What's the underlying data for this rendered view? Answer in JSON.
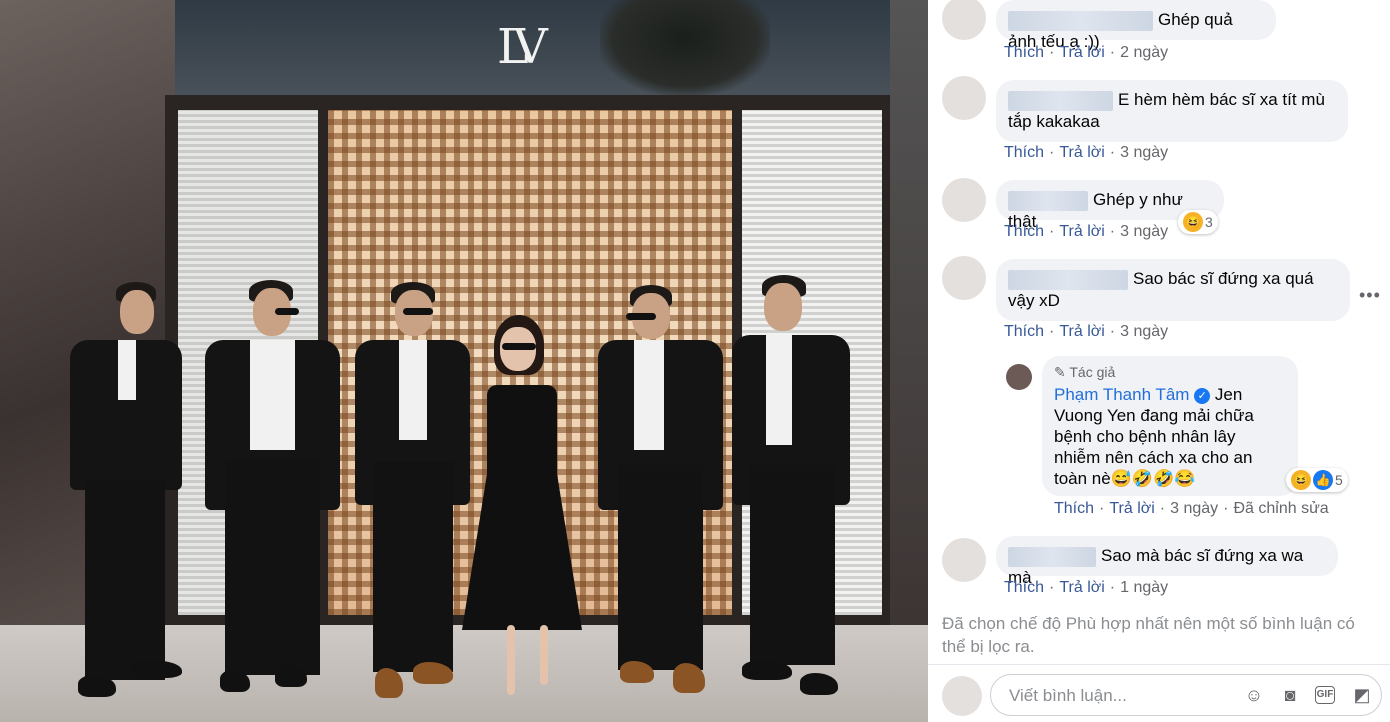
{
  "photo": {
    "logo_text": "LV"
  },
  "comments": [
    {
      "text": "Ghép quả ảnh tếu ạ :))",
      "like": "Thích",
      "reply": "Trả lời",
      "time": "2 ngày"
    },
    {
      "text": "E hèm hèm bác sĩ xa tít mù tắp kakakaa",
      "like": "Thích",
      "reply": "Trả lời",
      "time": "3 ngày"
    },
    {
      "text": "Ghép y như thật",
      "like": "Thích",
      "reply": "Trả lời",
      "time": "3 ngày",
      "reaction_count": "3"
    },
    {
      "text": "Sao bác sĩ đứng xa quá vậy xD",
      "like": "Thích",
      "reply": "Trả lời",
      "time": "3 ngày"
    },
    {
      "text": "Sao mà bác sĩ đứng xa wa mà",
      "like": "Thích",
      "reply": "Trả lời",
      "time": "1 ngày"
    }
  ],
  "author_reply": {
    "badge": "Tác giả",
    "name": "Phạm Thanh Tâm",
    "text": "Jen Vuong Yen đang mải chữa bệnh cho bệnh nhân lây nhiễm nên cách xa cho an toàn nè",
    "emojis": "😅🤣🤣😂",
    "like": "Thích",
    "reply": "Trả lời",
    "time": "3 ngày",
    "edited": "Đã chỉnh sửa",
    "reaction_count": "5"
  },
  "filter_notice": "Đã chọn chế độ Phù hợp nhất nên một số bình luận có thể bị lọc ra.",
  "composer": {
    "placeholder": "Viết bình luận..."
  },
  "colors": {
    "link": "#385898",
    "author_name": "#216fdb",
    "bubble_bg": "#f0f2f5"
  }
}
